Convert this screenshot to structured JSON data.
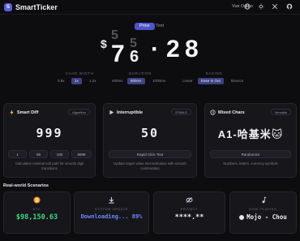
{
  "header": {
    "brand": "SmartTicker",
    "nav_link": "Vue Demo",
    "icons": [
      "globe-icon",
      "theme-icon",
      "x-icon",
      "github-icon"
    ]
  },
  "tabs": [
    {
      "label": "Price",
      "active": true
    },
    {
      "label": "Text",
      "active": false
    }
  ],
  "display": {
    "currency": "$",
    "digits": [
      "7",
      "6",
      "·",
      "2",
      "8"
    ],
    "ghost_digits": [
      "5",
      "5"
    ]
  },
  "controls": {
    "char_width": {
      "label": "CHAR WIDTH",
      "options": [
        "0.8x",
        "1x",
        "1.2x"
      ],
      "selected": "1x"
    },
    "duration": {
      "label": "DURATION",
      "options": [
        "400ms",
        "800ms",
        "1000ms"
      ],
      "selected": "800ms"
    },
    "easing": {
      "label": "EASING",
      "options": [
        "Linear",
        "Ease In Out",
        "Bounce"
      ],
      "selected": "Ease In Out"
    }
  },
  "cards": [
    {
      "title": "Smart Diff",
      "badge": "Algorithm",
      "value": "999",
      "buttons": [
        "1",
        "99",
        "100",
        "9999"
      ],
      "desc": "Calculates minimal edit path for smooth digit transitions"
    },
    {
      "title": "Interruptible",
      "badge": "STABLE",
      "value": "50",
      "buttons": [
        "Rapid Click Test"
      ],
      "desc": "Update target value mid-animation with smooth continuation"
    },
    {
      "title": "Mixed Chars",
      "badge": "Versatile",
      "value": "A1-哈基米🐱",
      "buttons": [
        "Randomize"
      ],
      "desc": "Numbers, letters, currency symbols"
    }
  ],
  "section_title": "Real-world Scenarios",
  "scenarios": [
    {
      "label": "BTC",
      "value": "$98,150.63",
      "color": "#3ddc84",
      "icon": "bitcoin-icon"
    },
    {
      "label": "SYSTEM UPDATE",
      "value": "Downloading... 89%",
      "color": "#6e8cff",
      "icon": "download-icon"
    },
    {
      "label": "PRIVACY",
      "value": "****.**",
      "color": "#f0f0f0",
      "icon": "eye-off-icon"
    },
    {
      "label": "NOW PLAYING",
      "value": "Mojo - Chou",
      "color": "#f0f0f0",
      "icon": "music-icon"
    }
  ]
}
